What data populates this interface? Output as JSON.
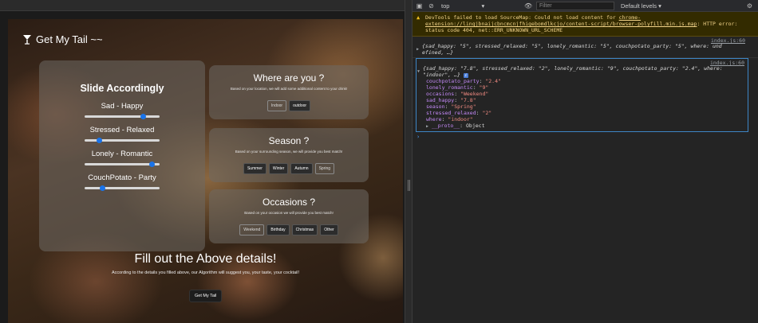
{
  "app": {
    "brand": "Get My Tail ~~",
    "sliders_title": "Slide Accordingly",
    "sliders": [
      {
        "label": "Sad - Happy",
        "value": 0.78
      },
      {
        "label": "Stressed - Relaxed",
        "value": 0.2
      },
      {
        "label": "Lonely - Romantic",
        "value": 0.9
      },
      {
        "label": "CouchPotato - Party",
        "value": 0.24
      }
    ],
    "where": {
      "title": "Where are you ?",
      "subtitle": "Based on your location, we will add some additional content to your drink!",
      "options": [
        "Indoor",
        "outdoor"
      ]
    },
    "season": {
      "title": "Season ?",
      "subtitle": "Based on your surrounding season, we will provide you best match!",
      "options": [
        "Summer",
        "Winter",
        "Autumn",
        "Spring"
      ]
    },
    "occasions": {
      "title": "Occasions ?",
      "subtitle": "Based on your occasion we will provide you best match!",
      "options": [
        "Weekend",
        "Birthday",
        "Christmas",
        "Other"
      ]
    },
    "cta_title": "Fill out the Above details!",
    "cta_text": "According to the details you filled above, our Algorithm will suggest you, your taste, your cocktail!",
    "cta_button": "Get My Tail"
  },
  "devtools": {
    "context": "top",
    "filter_placeholder": "Filter",
    "levels": "Default levels ▾",
    "warning_prefix": "DevTools failed to load SourceMap: Could not load content for ",
    "warning_link": "chrome-extension://lingjbnaijcbncmcnjfhigebomdlkcjo/content-script/browser-polyfill.min.js.map",
    "warning_suffix": ": HTTP error: status code 404, net::ERR_UNKNOWN_URL_SCHEME",
    "log1_source": "index.js:60",
    "log1_line1": "{sad_happy: \"5\", stressed_relaxed: \"5\", lonely_romantic: \"5\", couchpotato_party: \"5\", where: und",
    "log1_line2": "efined, …}",
    "log2_source": "index.js:60",
    "log2_line1": "{sad_happy: \"7.8\", stressed_relaxed: \"2\", lonely_romantic: \"9\", couchpotato_party: \"2.4\", where:",
    "log2_line2": "\"indoor\", …}",
    "props": [
      {
        "key": "couchpotato_party",
        "value": "\"2.4\""
      },
      {
        "key": "lonely_romantic",
        "value": "\"9\""
      },
      {
        "key": "occasions",
        "value": "\"Weekend\""
      },
      {
        "key": "sad_happy",
        "value": "\"7.8\""
      },
      {
        "key": "season",
        "value": "\"Spring\""
      },
      {
        "key": "stressed_relaxed",
        "value": "\"2\""
      },
      {
        "key": "where",
        "value": "\"indoor\""
      }
    ],
    "proto_key": "__proto__",
    "proto_value": "Object",
    "prompt": "›"
  },
  "colors": {
    "slider_accent": "#1a73e8",
    "warning_bg": "#332b00",
    "selection_border": "#3d86c6"
  }
}
